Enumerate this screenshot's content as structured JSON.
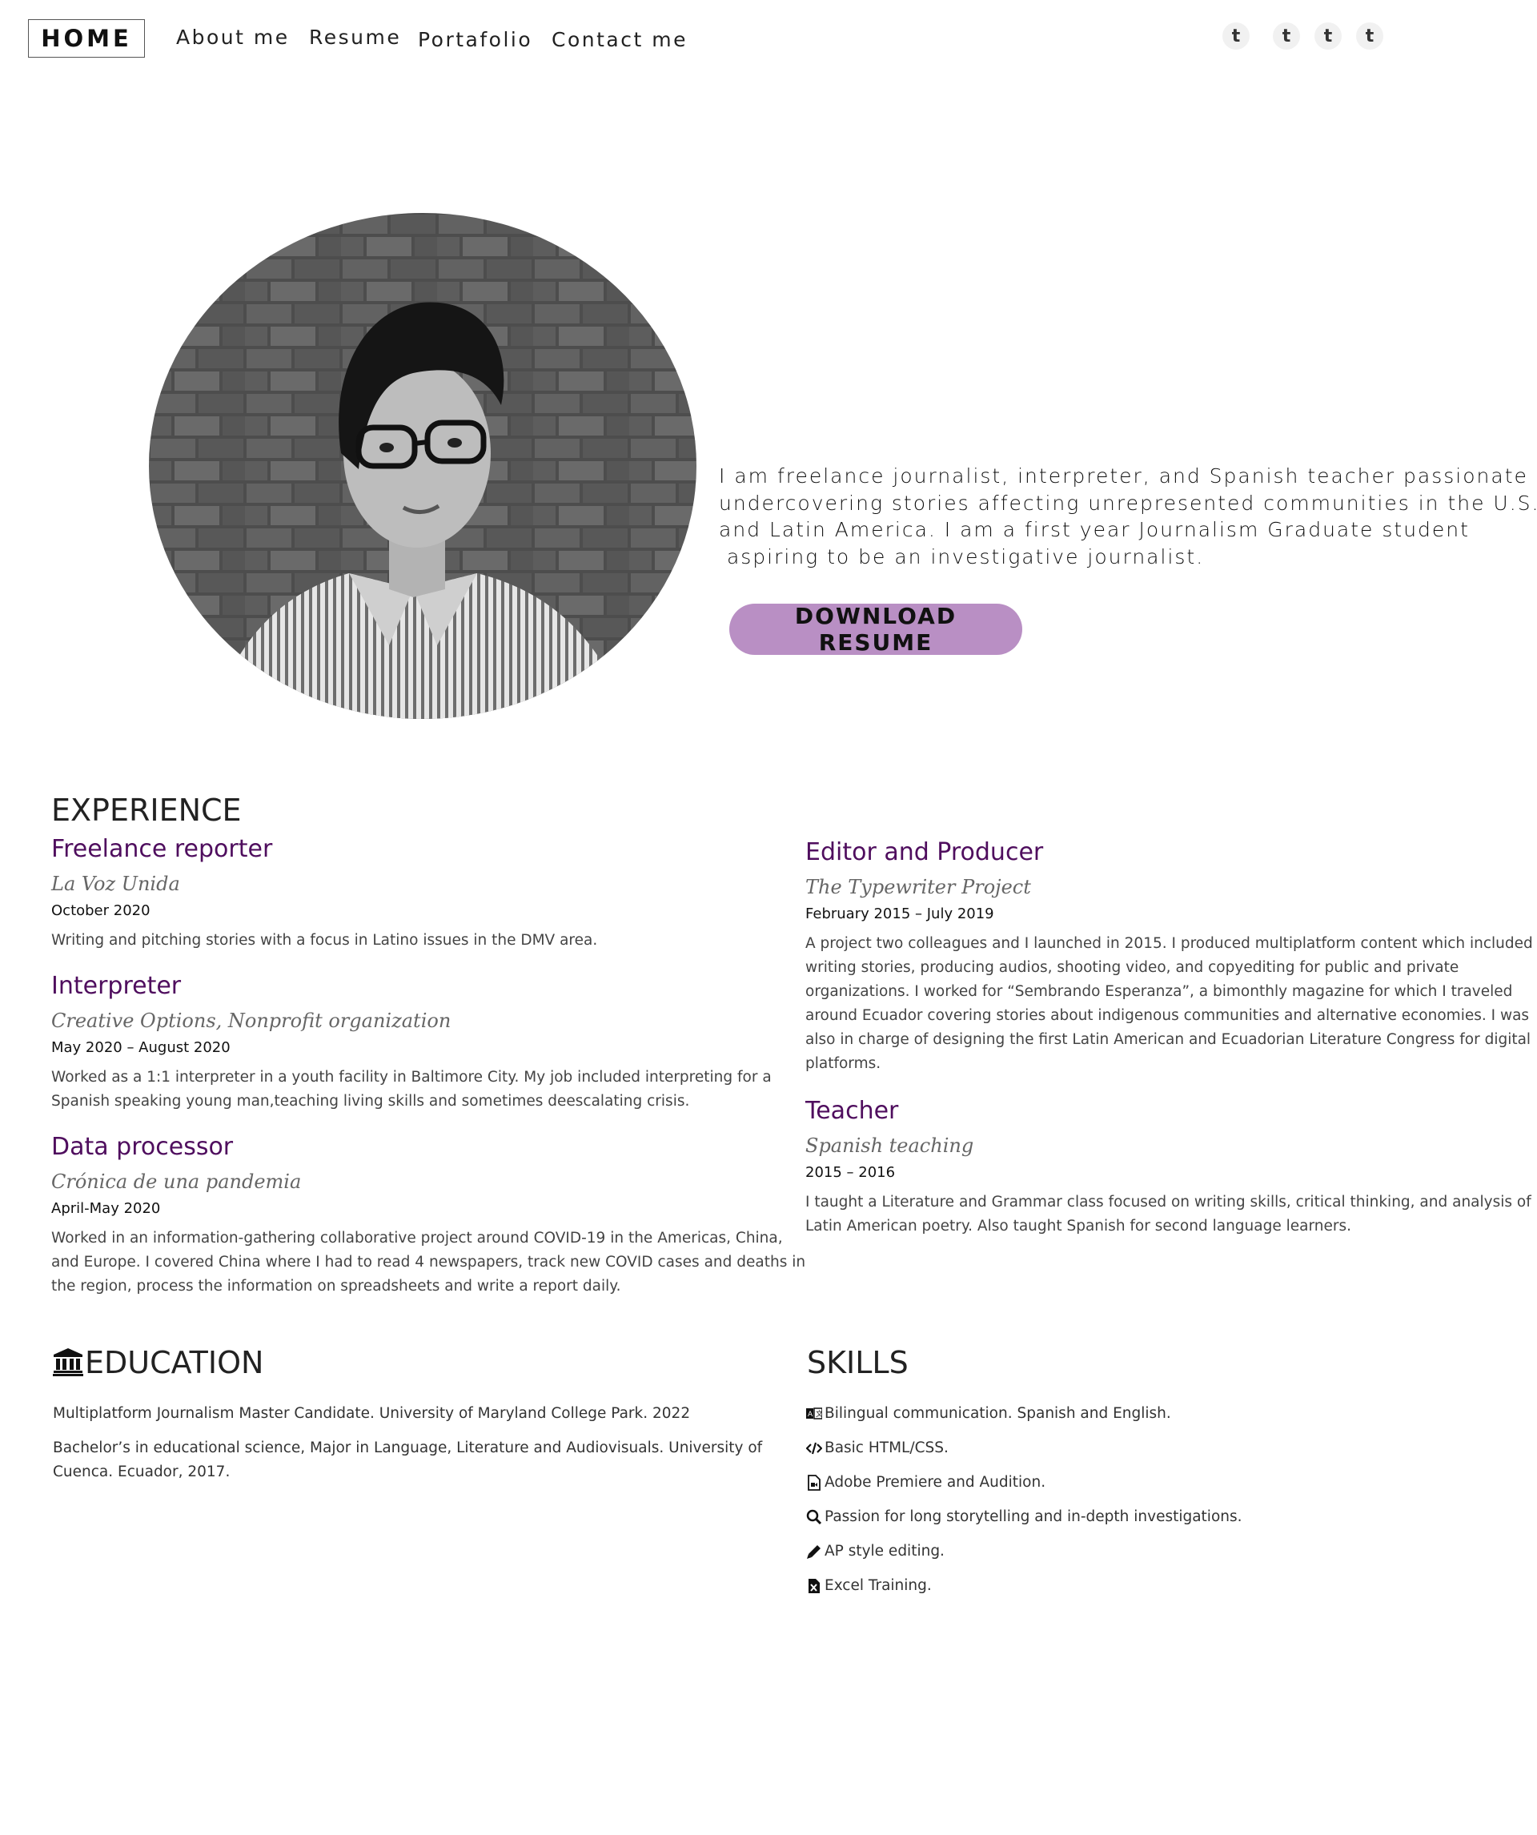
{
  "nav": {
    "home": "HOME",
    "links": [
      "About me",
      "Resume",
      "Portafolio",
      "Contact me"
    ],
    "social": [
      {
        "glyph": "t",
        "icon": "tumblr-icon"
      },
      {
        "glyph": "t",
        "icon": "tumblr-icon"
      },
      {
        "glyph": "t",
        "icon": "tumblr-icon"
      },
      {
        "glyph": "t",
        "icon": "tumblr-icon"
      }
    ]
  },
  "hero": {
    "intro_lines": [
      "I am freelance journalist, interpreter, and Spanish teacher passionate for",
      "undercovering stories affecting unrepresented communities in the U.S.",
      "and Latin America. I am a first year Journalism Graduate student",
      " aspiring to be an investigative journalist."
    ],
    "download_label": "DOWNLOAD RESUME",
    "accent": "#b98fc4"
  },
  "experience": {
    "title": "EXPERIENCE",
    "title_color": "#4f0e5e",
    "jobs": [
      {
        "title": "Freelance reporter",
        "org": "La Voz Unida",
        "date": "October 2020",
        "desc": [
          "Writing and pitching stories with a focus in Latino issues in the DMV area."
        ]
      },
      {
        "title": "Interpreter",
        "org": "Creative Options, Nonprofit organization",
        "date": "May 2020 – August 2020",
        "desc": [
          "Worked as a 1:1 interpreter in a youth facility in Baltimore City. My job included interpreting for a",
          "Spanish speaking young man,teaching living skills and sometimes deescalating crisis."
        ]
      },
      {
        "title": "Data processor",
        "org": "Crónica de una pandemia",
        "date": "April-May 2020",
        "desc": [
          "Worked in an information-gathering collaborative project around COVID-19 in the Americas, China,",
          "and Europe. I covered China where I had to read 4 newspapers, track new COVID cases and deaths in",
          "the region, process the information on spreadsheets and write a report daily."
        ]
      },
      {
        "title": "Editor and Producer",
        "org": "The Typewriter Project",
        "date": "February 2015 – July 2019",
        "desc": [
          "A project two colleagues and I launched in 2015. I produced multiplatform content which included",
          "writing stories, producing audios, shooting video, and copyediting for public and private",
          "organizations. I worked for “Sembrando Esperanza”, a bimonthly magazine for which I traveled",
          "around Ecuador covering stories about indigenous communities and alternative economies. I was",
          "also in charge of designing the first Latin American and Ecuadorian Literature Congress for digital",
          "platforms."
        ]
      },
      {
        "title": "Teacher",
        "org": "Spanish teaching",
        "date": "2015 – 2016",
        "desc": [
          "I taught a Literature and Grammar class focused on writing skills, critical thinking, and analysis of",
          "Latin American poetry. Also taught Spanish for second language learners."
        ]
      }
    ]
  },
  "education": {
    "title": "EDUCATION",
    "icon": "university-icon",
    "items": [
      [
        "Multiplatform Journalism Master Candidate. University of Maryland College Park. 2022"
      ],
      [
        "Bachelor’s in educational science, Major in Language, Literature and Audiovisuals. University of",
        "Cuenca. Ecuador, 2017."
      ]
    ]
  },
  "skills": {
    "title": "SKILLS",
    "items": [
      {
        "icon": "language-icon",
        "text": "Bilingual communication. Spanish and English."
      },
      {
        "icon": "code-icon",
        "text": "Basic HTML/CSS."
      },
      {
        "icon": "video-file-icon",
        "text": "Adobe Premiere and Audition."
      },
      {
        "icon": "search-icon",
        "text": "Passion for long storytelling and in-depth investigations."
      },
      {
        "icon": "pencil-icon",
        "text": "AP style editing."
      },
      {
        "icon": "excel-file-icon",
        "text": "Excel Training."
      }
    ]
  }
}
